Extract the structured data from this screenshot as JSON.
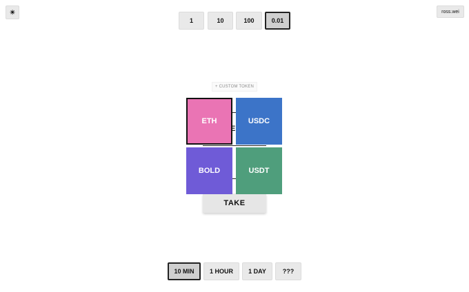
{
  "header": {
    "theme_toggle_icon": "☀",
    "user_label": "ross.wei"
  },
  "amounts": {
    "options": [
      "1",
      "10",
      "100",
      "0.01"
    ],
    "selected": "0.01"
  },
  "tokens": {
    "custom_token_label": "+ CUSTOM TOKEN",
    "items": [
      {
        "label": "ETH",
        "color": "#ea74b4",
        "selected": true
      },
      {
        "label": "USDC",
        "color": "#3c74c8",
        "selected": false
      },
      {
        "label": "BOLD",
        "color": "#6f5bd7",
        "selected": false
      },
      {
        "label": "USDT",
        "color": "#4f9e7c",
        "selected": false
      }
    ]
  },
  "action": {
    "take_label": "TAKE",
    "partial_text": "E"
  },
  "durations": {
    "options": [
      "10 MIN",
      "1 HOUR",
      "1 DAY",
      "???"
    ],
    "selected": "10 MIN"
  }
}
